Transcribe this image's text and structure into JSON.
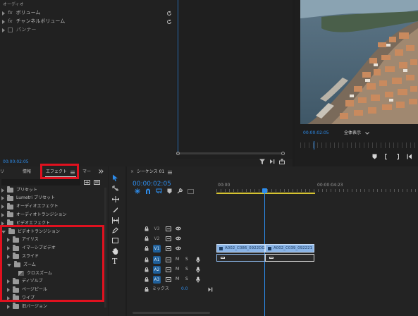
{
  "effect_controls": {
    "section": "オーディオ",
    "items": [
      {
        "fx": "fx",
        "label": "ボリューム"
      },
      {
        "fx": "fx",
        "label": "チャンネルボリューム"
      },
      {
        "fx": "",
        "label": "パンナー"
      }
    ],
    "timecode": "00:00:02:05"
  },
  "program_monitor": {
    "timecode": "00:00:02:05",
    "fit": "全体表示"
  },
  "project_panel": {
    "tabs": [
      "リ",
      "情報",
      "エフェクト",
      "マー"
    ],
    "active_tab": "エフェクト",
    "tree": [
      {
        "label": "プリセット",
        "level": 0,
        "expanded": false,
        "icon": "folder"
      },
      {
        "label": "Lumetri プリセット",
        "level": 0,
        "expanded": false,
        "icon": "folder"
      },
      {
        "label": "オーディオエフェクト",
        "level": 0,
        "expanded": false,
        "icon": "folder"
      },
      {
        "label": "オーディオトランジション",
        "level": 0,
        "expanded": false,
        "icon": "folder"
      },
      {
        "label": "ビデオエフェクト",
        "level": 0,
        "expanded": false,
        "icon": "folder"
      },
      {
        "label": "ビデオトランジション",
        "level": 0,
        "expanded": true,
        "icon": "folder"
      },
      {
        "label": "アイリス",
        "level": 1,
        "expanded": false,
        "icon": "folder"
      },
      {
        "label": "イマーシブビデオ",
        "level": 1,
        "expanded": false,
        "icon": "folder"
      },
      {
        "label": "スライド",
        "level": 1,
        "expanded": false,
        "icon": "folder"
      },
      {
        "label": "ズーム",
        "level": 1,
        "expanded": true,
        "icon": "folder"
      },
      {
        "label": "クロスズーム",
        "level": 2,
        "expanded": false,
        "icon": "effect"
      },
      {
        "label": "ディゾルブ",
        "level": 1,
        "expanded": false,
        "icon": "folder"
      },
      {
        "label": "ページピール",
        "level": 1,
        "expanded": false,
        "icon": "folder"
      },
      {
        "label": "ワイプ",
        "level": 1,
        "expanded": false,
        "icon": "folder"
      },
      {
        "label": "旧バージョン",
        "level": 1,
        "expanded": false,
        "icon": "folder"
      }
    ]
  },
  "timeline": {
    "sequence_tab": "シーケンス 01",
    "timecode": "00:00:02:05",
    "ruler": [
      "00:00",
      "00:00:04:23"
    ],
    "video_tracks": [
      "V3",
      "V2",
      "V1"
    ],
    "audio_tracks": [
      "A1",
      "A2",
      "A3"
    ],
    "mix_label": "ミックス",
    "mix_value": "0.0",
    "clips": [
      "A002_C086_0922DG",
      "A002_C039_092221"
    ]
  },
  "colors": {
    "accent": "#2d8ceb",
    "highlight": "#e0111f",
    "playhead": "#2d8ceb",
    "clip": "#8ab4e6",
    "workarea": "#d6c332"
  }
}
